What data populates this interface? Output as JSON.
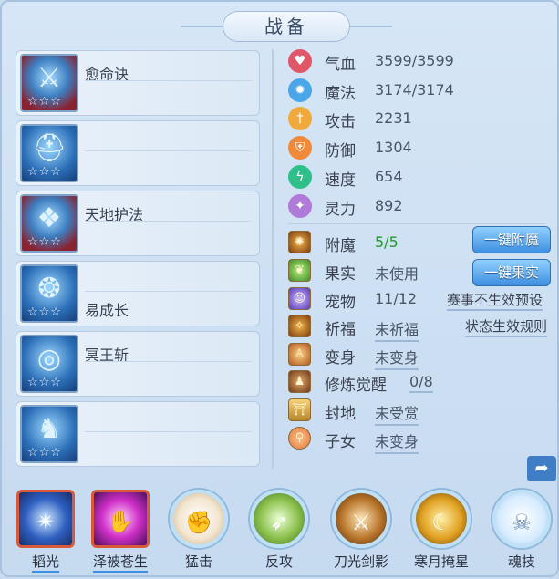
{
  "title": "战备",
  "equipment": [
    {
      "name": "愈命诀",
      "stars": "☆☆☆",
      "icon": "weapon-icon"
    },
    {
      "name": "",
      "stars": "☆☆☆",
      "icon": "helmet-icon"
    },
    {
      "name": "天地护法",
      "stars": "☆☆☆",
      "icon": "armor-icon"
    },
    {
      "name": "易成长",
      "stars": "☆☆☆",
      "icon": "necklace-icon"
    },
    {
      "name": "冥王斩",
      "stars": "☆☆☆",
      "icon": "belt-icon"
    },
    {
      "name": "",
      "stars": "☆☆☆",
      "icon": "boots-icon"
    }
  ],
  "stats": [
    {
      "label": "气血",
      "value": "3599/3599",
      "icon": "heart-icon",
      "color": "#e2566a"
    },
    {
      "label": "魔法",
      "value": "3174/3174",
      "icon": "mana-icon",
      "color": "#4aa6e8"
    },
    {
      "label": "攻击",
      "value": "2231",
      "icon": "sword-icon",
      "color": "#f0a93a"
    },
    {
      "label": "防御",
      "value": "1304",
      "icon": "shield-icon",
      "color": "#f08a3a"
    },
    {
      "label": "速度",
      "value": "654",
      "icon": "speed-icon",
      "color": "#2fbf8a"
    },
    {
      "label": "灵力",
      "value": "892",
      "icon": "spirit-icon",
      "color": "#b07ad8"
    }
  ],
  "misc": [
    {
      "label": "附魔",
      "value": "5/5",
      "icon": "enchant-icon"
    },
    {
      "label": "果实",
      "value": "未使用",
      "icon": "fruit-icon"
    },
    {
      "label": "宠物",
      "value": "11/12",
      "icon": "pet-icon"
    },
    {
      "label": "祈福",
      "value": "未祈福",
      "icon": "blessing-icon"
    },
    {
      "label": "变身",
      "value": "未变身",
      "icon": "transform-icon"
    },
    {
      "label": "修炼觉醒",
      "value": "0/8",
      "icon": "cultivation-icon"
    },
    {
      "label": "封地",
      "value": "未受赏",
      "icon": "fief-icon"
    },
    {
      "label": "子女",
      "value": "未变身",
      "icon": "child-icon"
    }
  ],
  "buttons": {
    "enchant_all": "一键附魔",
    "fruit_all": "一键果实"
  },
  "links": {
    "preset_invalid": "赛事不生效预设",
    "status_rules": "状态生效规则"
  },
  "skills": [
    {
      "name": "韬光",
      "icon": "glow-orb-icon"
    },
    {
      "name": "泽被苍生",
      "icon": "blessing-hand-icon"
    },
    {
      "name": "猛击",
      "icon": "fist-icon"
    },
    {
      "name": "反攻",
      "icon": "counter-icon"
    },
    {
      "name": "刀光剑影",
      "icon": "blade-icon"
    },
    {
      "name": "寒月掩星",
      "icon": "moon-icon"
    },
    {
      "name": "魂技",
      "icon": "skull-icon"
    }
  ]
}
